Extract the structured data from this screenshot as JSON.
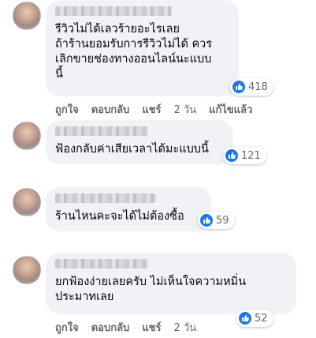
{
  "comments": [
    {
      "text": "รีวิวไม่ได้เลวร้ายอะไรเลย\nถ้าร้านยอมรับการรีวิวไม่ได้ ควร\nเลิกขายช่องทางออนไลน์นะแบบ\nนี้",
      "reaction_count": "418",
      "actions": {
        "like": "ถูกใจ",
        "reply": "ตอบกลับ",
        "share": "แชร์",
        "time": "2 วัน",
        "edited": "แก้ไขแล้ว"
      }
    },
    {
      "text": "ฟ้องกลับค่าเสียเวลาได้มะแบบนี้",
      "reaction_count": "121"
    },
    {
      "text": "ร้านไหนคะจะได้ไม่ต้องซื้อ",
      "reaction_count": "59"
    },
    {
      "text": "ยกฟ้องง่ายเลยครับ ไม่เห็นใจความหมิ่น\nประมาทเลย",
      "reaction_count": "52",
      "actions": {
        "like": "ถูกใจ",
        "reply": "ตอบกลับ",
        "share": "แชร์",
        "time": "2 วัน"
      }
    }
  ],
  "colors": {
    "bubble": "#f0f2f5",
    "like_blue": "#1877f2",
    "meta_gray": "#65676b"
  },
  "icons": {
    "reaction": "like-thumb-icon"
  }
}
